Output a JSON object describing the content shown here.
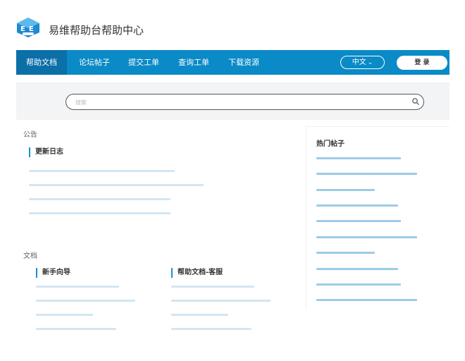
{
  "header": {
    "site_title": "易维帮助台帮助中心"
  },
  "nav": {
    "items": [
      "帮助文档",
      "论坛帖子",
      "提交工单",
      "查询工单",
      "下载资源"
    ],
    "language": "中文",
    "login_label": "登 录"
  },
  "search": {
    "placeholder": "搜索"
  },
  "announcements": {
    "section_label": "公告",
    "changelog_heading": "更新日志"
  },
  "docs": {
    "section_label": "文档",
    "beginner_heading": "新手向导",
    "support_heading": "帮助文档-客服"
  },
  "hot_posts": {
    "title": "热门帖子"
  },
  "colors": {
    "nav_bg": "#0a8ac6",
    "nav_active": "#0b6fa8",
    "accent": "#1d8fd0",
    "placeholder_line": "#d2e6f3",
    "placeholder_line_dark": "#9ecbe6"
  }
}
